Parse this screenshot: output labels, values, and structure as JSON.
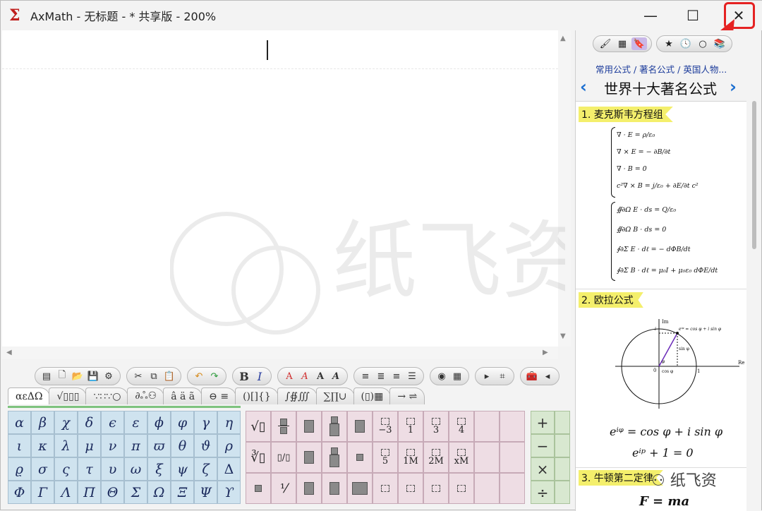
{
  "window": {
    "title": "AxMath - 无标题 - * 共享版 - 200%",
    "minimize": "—",
    "maximize": "☐",
    "close": "✕"
  },
  "toolbar": {
    "bold": "B",
    "italic": "I",
    "font_a": [
      "A",
      "A",
      "A",
      "A"
    ]
  },
  "symbol_tabs": [
    "αεΔΩ",
    "√▯▯▯",
    "∵∷∵○",
    "∂ஃ⚇",
    "â ä ã",
    "⊖ ≡",
    "()[]{}",
    "∫∯∭",
    "∑∏∪",
    "(▯)▦",
    "→ ⇌"
  ],
  "greek": [
    "α",
    "β",
    "χ",
    "δ",
    "ϵ",
    "ε",
    "ϕ",
    "φ",
    "γ",
    "η",
    "ι",
    "κ",
    "λ",
    "μ",
    "ν",
    "π",
    "ϖ",
    "θ",
    "ϑ",
    "ρ",
    "ϱ",
    "σ",
    "ς",
    "τ",
    "υ",
    "ω",
    "ξ",
    "ψ",
    "ζ",
    "Δ",
    "Φ",
    "Γ",
    "Λ",
    "Π",
    "Θ",
    "Σ",
    "Ω",
    "Ξ",
    "Ψ",
    "ϒ"
  ],
  "templates": {
    "sqrt": "√▯",
    "nroot": "∛▯",
    "labels": [
      "−3",
      "1",
      "3",
      "4",
      "5",
      "1M",
      "2M",
      "xM"
    ]
  },
  "operators": [
    "+",
    "−",
    "×",
    "÷"
  ],
  "right_panel": {
    "breadcrumb": "常用公式 / 著名公式 / 英国人物...",
    "title": "世界十大著名公式",
    "prev": "‹",
    "next": "›",
    "sections": [
      {
        "label": "1. 麦克斯韦方程组"
      },
      {
        "label": "2. 欧拉公式"
      },
      {
        "label": "3. 牛顿第二定律"
      }
    ],
    "maxwell_diff": [
      "∇ · E = ρ/ε₀",
      "∇ × E = − ∂B/∂t",
      "∇ · B = 0",
      "c²∇ × B = j/ε₀ + ∂E/∂t c²"
    ],
    "maxwell_int": [
      "∯∂Ω E · ds = Q/ε₀",
      "∯∂Ω B · ds = 0",
      "∮∂Σ E · dℓ = − dΦB/dt",
      "∮∂Σ B · dℓ = μ₀I + μ₀ε₀ dΦE/dt"
    ],
    "euler_diagram": {
      "im": "Im",
      "re": "Re",
      "eq": "eⁱᵠ = cos φ + i sin φ",
      "sin": "sin φ",
      "cos": "cos φ",
      "i": "i",
      "one": "1",
      "zero": "0",
      "phi": "φ"
    },
    "euler_eq1": "eⁱᵠ = cos φ + i sin φ",
    "euler_eq2": "eⁱᵖ + 1 = 0",
    "newton": "F = ma"
  },
  "watermark": "纸飞资",
  "corner_sigil": "⚇ 纸飞资"
}
